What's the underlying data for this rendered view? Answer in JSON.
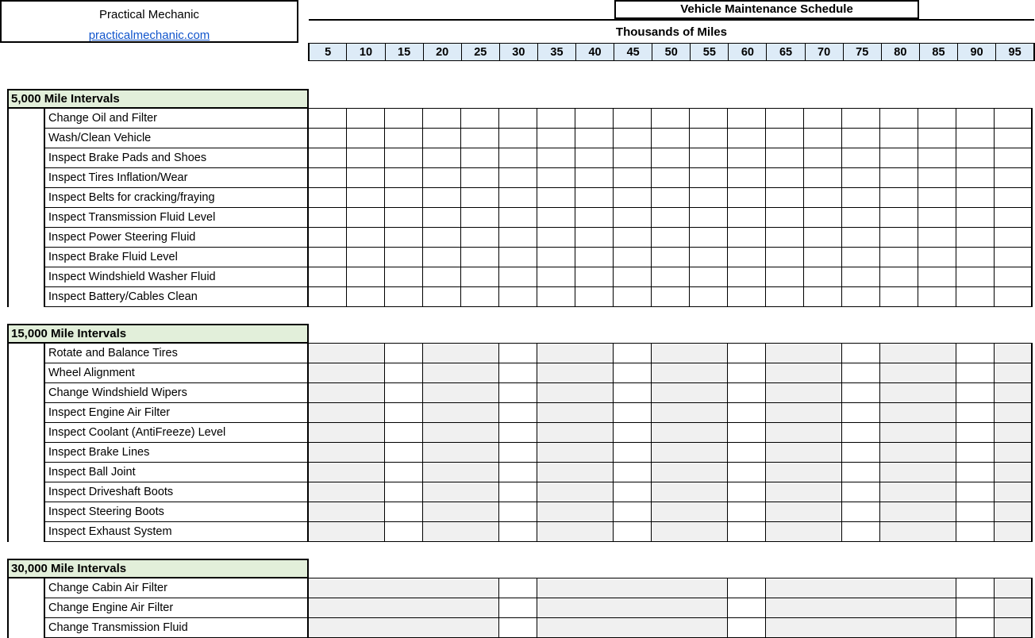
{
  "brand": {
    "name": "Practical Mechanic",
    "url": "practicalmechanic.com"
  },
  "title": "Vehicle Maintenance Schedule",
  "axis_header": "Thousands of Miles",
  "mileage_columns": [
    "5",
    "10",
    "15",
    "20",
    "25",
    "30",
    "35",
    "40",
    "45",
    "50",
    "55",
    "60",
    "65",
    "70",
    "75",
    "80",
    "85",
    "90",
    "95"
  ],
  "colors": {
    "section_header_bg": "#E2EFDA",
    "mileage_header_bg": "#DDEBF7",
    "shaded_cell_bg": "#F0F0F0",
    "link": "#1155CC",
    "border": "#000000"
  },
  "sections": [
    {
      "label": "5,000 Mile Intervals",
      "interval": 5,
      "shade_group": 1,
      "tasks": [
        "Change Oil and Filter",
        "Wash/Clean Vehicle",
        "Inspect Brake Pads and Shoes",
        "Inspect Tires Inflation/Wear",
        "Inspect Belts for cracking/fraying",
        "Inspect Transmission Fluid Level",
        "Inspect Power Steering Fluid",
        "Inspect Brake Fluid Level",
        "Inspect Windshield Washer Fluid",
        "Inspect Battery/Cables Clean"
      ]
    },
    {
      "label": "15,000 Mile Intervals",
      "interval": 15,
      "shade_group": 3,
      "tasks": [
        "Rotate and Balance Tires",
        "Wheel Alignment",
        "Change Windshield Wipers",
        "Inspect Engine Air Filter",
        "Inspect Coolant (AntiFreeze) Level",
        "Inspect Brake Lines",
        "Inspect Ball Joint",
        "Inspect Driveshaft Boots",
        "Inspect Steering Boots",
        "Inspect Exhaust System"
      ]
    },
    {
      "label": "30,000 Mile Intervals",
      "interval": 30,
      "shade_group": 6,
      "tasks": [
        "Change Cabin Air Filter",
        "Change Engine Air Filter",
        "Change Transmission Fluid"
      ]
    }
  ],
  "chart_data": {
    "type": "table",
    "title": "Vehicle Maintenance Schedule",
    "xlabel": "Thousands of Miles",
    "categories": [
      "5",
      "10",
      "15",
      "20",
      "25",
      "30",
      "35",
      "40",
      "45",
      "50",
      "55",
      "60",
      "65",
      "70",
      "75",
      "80",
      "85",
      "90",
      "95"
    ],
    "grid": true,
    "legend": "none",
    "series": [
      {
        "name": "5,000 Mile Intervals",
        "values": [
          1,
          1,
          1,
          1,
          1,
          1,
          1,
          1,
          1,
          1,
          1,
          1,
          1,
          1,
          1,
          1,
          1,
          1,
          1
        ]
      },
      {
        "name": "15,000 Mile Intervals",
        "values": [
          0,
          0,
          1,
          0,
          0,
          1,
          0,
          0,
          1,
          0,
          0,
          1,
          0,
          0,
          1,
          0,
          0,
          1,
          0
        ]
      },
      {
        "name": "30,000 Mile Intervals",
        "values": [
          0,
          0,
          0,
          0,
          0,
          1,
          0,
          0,
          0,
          0,
          0,
          1,
          0,
          0,
          0,
          0,
          0,
          1,
          0
        ]
      }
    ]
  }
}
